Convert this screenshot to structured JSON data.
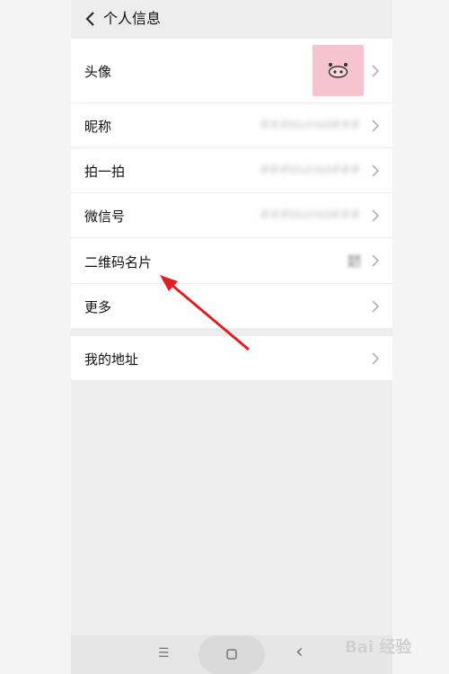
{
  "header": {
    "title": "个人信息"
  },
  "rows": [
    {
      "label": "头像"
    },
    {
      "label": "昵称",
      "value": "###blurred###"
    },
    {
      "label": "拍一拍",
      "value": "###blurred###"
    },
    {
      "label": "微信号",
      "value": "###blurred###"
    },
    {
      "label": "二维码名片"
    },
    {
      "label": "更多"
    },
    {
      "label": "我的地址"
    }
  ],
  "colors": {
    "background": "#ededed",
    "row_bg": "#ffffff",
    "avatar_bg": "#f6c4ce",
    "annotation_arrow": "#e02020"
  },
  "icons": {
    "back": "chevron-left-icon",
    "row_arrow": "chevron-right-icon",
    "qr": "qr-code-icon",
    "nav_menu": "menu-icon",
    "nav_home": "home-square-icon",
    "nav_back": "back-triangle-icon"
  },
  "navbar": {
    "menu_glyph": "☰",
    "back_glyph": "‹"
  },
  "watermark": {
    "text": "Bai 经验"
  }
}
